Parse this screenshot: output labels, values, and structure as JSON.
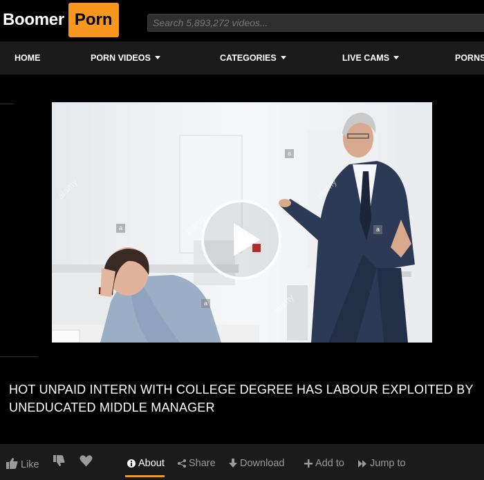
{
  "header": {
    "logo_part1": "Boomer",
    "logo_part2": "Porn",
    "search_placeholder": "Search 5,893,272 videos..."
  },
  "nav": {
    "items": [
      {
        "label": "HOME",
        "dropdown": false
      },
      {
        "label": "PORN VIDEOS",
        "dropdown": true
      },
      {
        "label": "CATEGORIES",
        "dropdown": true
      },
      {
        "label": "LIVE CAMS",
        "dropdown": true
      },
      {
        "label": "PORNS",
        "dropdown": false
      }
    ]
  },
  "video": {
    "watermark_text": "alamy",
    "watermark_badge": "a"
  },
  "title": "HOT UNPAID INTERN WITH COLLEGE DEGREE HAS LABOUR EXPLOITED BY UNEDUCATED MIDDLE MANAGER",
  "actions": {
    "like_label": "Like",
    "about_label": "About",
    "share_label": "Share",
    "download_label": "Download",
    "add_label": "Add to",
    "jump_label": "Jump to"
  },
  "colors": {
    "accent": "#f7971d",
    "background": "#000000",
    "bar": "#1b1b1b"
  }
}
